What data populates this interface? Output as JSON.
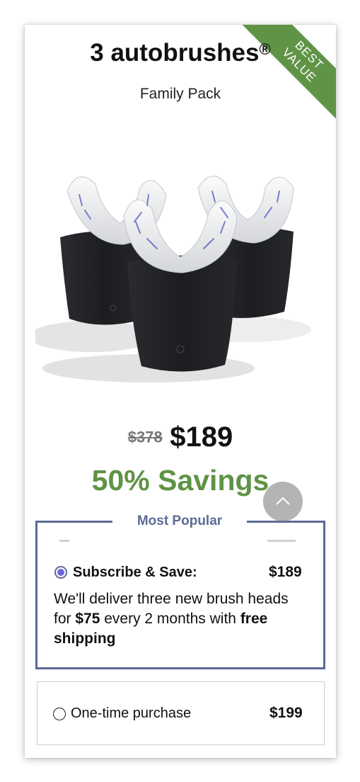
{
  "product": {
    "title": "3 autobrushes",
    "trademark": "®",
    "subtitle": "Family Pack",
    "badge_line1": "BEST",
    "badge_line2": "VALUE",
    "image_alt": "three black autobrush devices with white mouthpieces"
  },
  "pricing": {
    "original_price": "$378",
    "sale_price": "$189",
    "savings": "50% Savings"
  },
  "options": {
    "popular_label": "Most Popular",
    "subscribe": {
      "label": "Subscribe & Save:",
      "price": "$189",
      "selected": true,
      "desc_1": "We'll deliver three new brush heads for ",
      "desc_amount": "$75",
      "desc_2": " every 2 months with ",
      "desc_shipping": "free shipping"
    },
    "one_time": {
      "label": "One-time purchase",
      "price": "$199",
      "selected": false
    }
  },
  "colors": {
    "accent_green": "#5f9346",
    "border_blue": "#5c6b95",
    "radio_fill": "#6b66d9"
  },
  "icons": {
    "scroll_top": "chevron-up-icon"
  }
}
